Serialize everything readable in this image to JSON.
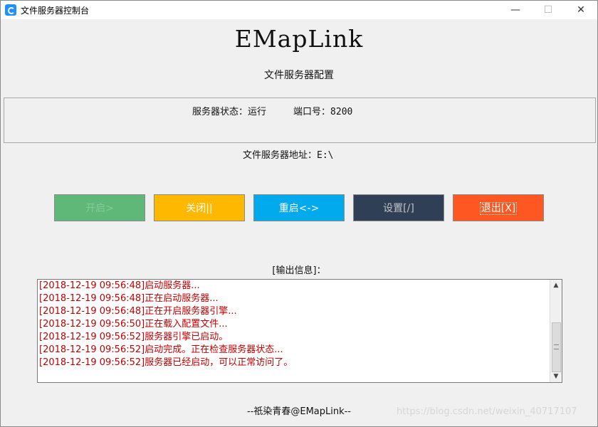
{
  "window": {
    "title": "文件服务器控制台"
  },
  "header": {
    "brand": "EMapLink",
    "subtitle": "文件服务器配置"
  },
  "status": {
    "state_label": "服务器状态：",
    "state_value": "运行",
    "port_label": "端口号：",
    "port_value": "8200",
    "address_label": "文件服务器地址：",
    "address_value": "E:\\"
  },
  "buttons": {
    "start": "开启>",
    "close": "关闭||",
    "restart": "重启<->",
    "settings": "设置[/]",
    "exit": "退出[X]"
  },
  "output": {
    "label": "[输出信息]：",
    "lines": [
      "[2018-12-19 09:56:48]启动服务器...",
      "[2018-12-19 09:56:48]正在启动服务器...",
      "[2018-12-19 09:56:48]正在开启服务器引擎...",
      "[2018-12-19 09:56:50]正在载入配置文件...",
      "[2018-12-19 09:56:52]服务器引擎已启动。",
      "[2018-12-19 09:56:52]启动完成。正在检查服务器状态...",
      "[2018-12-19 09:56:52]服务器已经启动，可以正常访问了。"
    ]
  },
  "footer": "--祇染青春@EMapLink--",
  "watermark": "https://blog.csdn.net/weixin_40717107",
  "colors": {
    "start": "#5fb878",
    "close": "#ffb800",
    "restart": "#01aaed",
    "settings": "#2f4056",
    "exit": "#ff5722",
    "log_text": "#c00000"
  }
}
